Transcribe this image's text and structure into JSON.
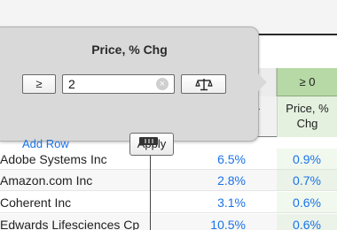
{
  "popup": {
    "title": "Price, % Chg",
    "operator_label": "≥",
    "value": "2",
    "clear_label": "×",
    "add_row_label": "Add Row",
    "apply_label": "Apply"
  },
  "table": {
    "filter_badge": "≥ 0",
    "header_stub": "-",
    "price_header": "Price, % Chg",
    "rows": [
      {
        "name": "Adobe Systems Inc",
        "v1": "6.5%",
        "v2": "0.9%"
      },
      {
        "name": "Amazon.com Inc",
        "v1": "2.8%",
        "v2": "0.7%"
      },
      {
        "name": "Coherent Inc",
        "v1": "3.1%",
        "v2": "0.6%"
      },
      {
        "name": "Edwards Lifesciences Cp",
        "v1": "10.5%",
        "v2": "0.6%"
      }
    ]
  },
  "colors": {
    "link_blue": "#1a73e8",
    "filter_green": "#b6d9a6",
    "popup_gray": "#d9d9d9"
  },
  "icons": {
    "operator": "greater-equal",
    "compare": "balance-scale-icon",
    "clear": "clear-x-icon"
  }
}
